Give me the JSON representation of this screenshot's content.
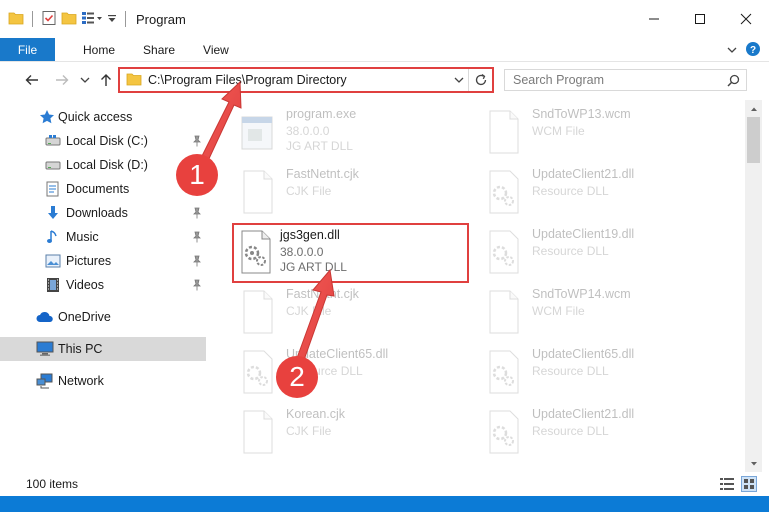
{
  "window": {
    "title": "Program"
  },
  "ribbon": {
    "file": "File",
    "tabs": [
      "Home",
      "Share",
      "View"
    ]
  },
  "address": {
    "path": "C:\\Program Files\\Program Directory"
  },
  "search": {
    "placeholder": "Search Program"
  },
  "nav": {
    "items": [
      {
        "label": "Quick access",
        "icon": "star-icon"
      },
      {
        "label": "Local Disk (C:)",
        "icon": "drive-icon"
      },
      {
        "label": "Local Disk (D:)",
        "icon": "drive-icon"
      },
      {
        "label": "Documents",
        "icon": "documents-icon"
      },
      {
        "label": "Downloads",
        "icon": "downloads-icon"
      },
      {
        "label": "Music",
        "icon": "music-icon"
      },
      {
        "label": "Pictures",
        "icon": "pictures-icon"
      },
      {
        "label": "Videos",
        "icon": "videos-icon"
      },
      {
        "label": "OneDrive",
        "icon": "cloud-icon"
      },
      {
        "label": "This PC",
        "icon": "computer-icon"
      },
      {
        "label": "Network",
        "icon": "network-icon"
      }
    ]
  },
  "files": {
    "left": [
      {
        "name": "program.exe",
        "line2": "38.0.0.0",
        "line3": "JG ART DLL",
        "icon": "exe-icon"
      },
      {
        "name": "FastNetnt.cjk",
        "line2": "CJK File",
        "line3": "",
        "icon": "file-icon"
      },
      {
        "name": "jgs3gen.dll",
        "line2": "38.0.0.0",
        "line3": "JG ART DLL",
        "icon": "dll-icon"
      },
      {
        "name": "FastNetnt.cjk",
        "line2": "CJK File",
        "line3": "",
        "icon": "file-icon"
      },
      {
        "name": "UpdateClient65.dll",
        "line2": "Resource DLL",
        "line3": "",
        "icon": "dll-icon"
      },
      {
        "name": "Korean.cjk",
        "line2": "CJK File",
        "line3": "",
        "icon": "file-icon"
      }
    ],
    "right": [
      {
        "name": "SndToWP13.wcm",
        "line2": "WCM File",
        "line3": "",
        "icon": "file-icon"
      },
      {
        "name": "UpdateClient21.dll",
        "line2": "Resource DLL",
        "line3": "",
        "icon": "dll-icon"
      },
      {
        "name": "UpdateClient19.dll",
        "line2": "Resource DLL",
        "line3": "",
        "icon": "dll-icon"
      },
      {
        "name": "SndToWP14.wcm",
        "line2": "WCM File",
        "line3": "",
        "icon": "file-icon"
      },
      {
        "name": "UpdateClient65.dll",
        "line2": "Resource DLL",
        "line3": "",
        "icon": "dll-icon"
      },
      {
        "name": "UpdateClient21.dll",
        "line2": "Resource DLL",
        "line3": "",
        "icon": "dll-icon"
      }
    ]
  },
  "status": {
    "count": "100 items"
  },
  "annotations": {
    "step1": "1",
    "step2": "2"
  },
  "colors": {
    "accent": "#1979ca",
    "highlight": "#e0403f",
    "selected_nav": "#d9d9d9"
  }
}
